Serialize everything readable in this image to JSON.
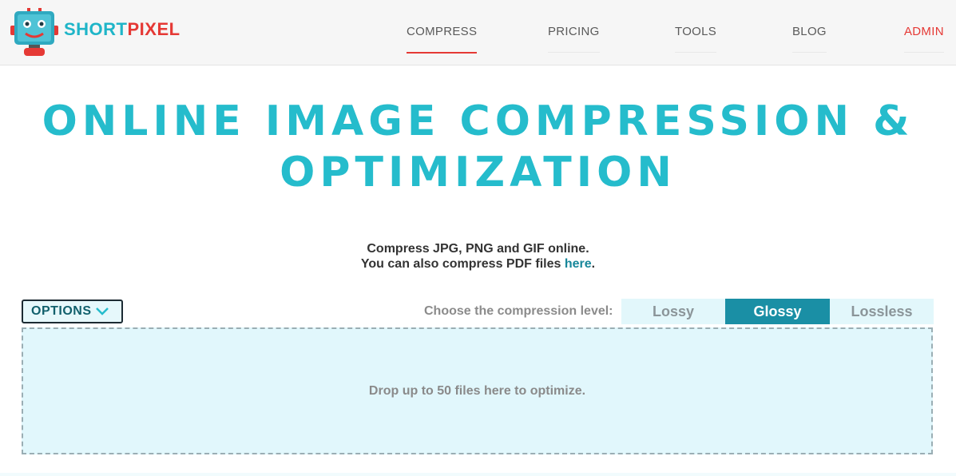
{
  "header": {
    "logo": {
      "text_short": "SHORT",
      "text_pixel": "PIXEL",
      "icon": "robot-logo-icon"
    },
    "nav": [
      {
        "label": "COMPRESS",
        "active": true
      },
      {
        "label": "PRICING",
        "active": false
      },
      {
        "label": "TOOLS",
        "active": false
      },
      {
        "label": "BLOG",
        "active": false
      },
      {
        "label": "ADMIN",
        "active": false
      }
    ]
  },
  "hero": {
    "title_line1": "ONLINE IMAGE COMPRESSION &",
    "title_line2": "OPTIMIZATION",
    "subtitle_line1": "Compress JPG, PNG and GIF online.",
    "subtitle_line2_prefix": "You can also compress PDF files ",
    "subtitle_link": "here",
    "subtitle_line2_suffix": "."
  },
  "options": {
    "label": "OPTIONS",
    "icon": "chevron-down-icon"
  },
  "compression": {
    "label": "Choose the compression level:",
    "levels": [
      "Lossy",
      "Glossy",
      "Lossless"
    ],
    "selected": "Glossy"
  },
  "dropzone": {
    "text": "Drop up to 50 files here to optimize."
  },
  "colors": {
    "brand_teal": "#25bccc",
    "brand_red": "#e53935",
    "selected_level": "#1a8fa5",
    "dropzone_bg": "#e1f7fc"
  }
}
